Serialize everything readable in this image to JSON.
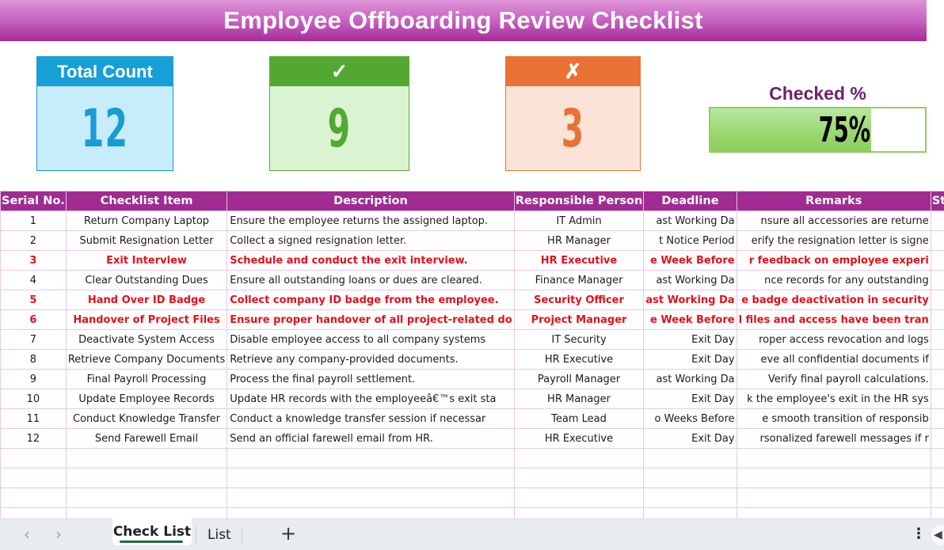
{
  "title": "Employee Offboarding Review Checklist",
  "kpis": {
    "total": {
      "label": "Total Count",
      "value": "12"
    },
    "checked": {
      "label": "✓",
      "value": "9"
    },
    "unchecked": {
      "label": "✗",
      "value": "3"
    }
  },
  "progress": {
    "label": "Checked %",
    "display": "75%",
    "fraction": 0.75
  },
  "colors": {
    "header_purple": "#a02b93",
    "pending_red": "#e3101c",
    "done_green": "#17a34a",
    "total_blue": "#179fd7",
    "checked_green": "#53a832",
    "unchecked_orange": "#e97134"
  },
  "table": {
    "columns": [
      "Serial No.",
      "Checklist Item",
      "Description",
      "Responsible Person",
      "Deadline",
      "Remarks",
      "Status"
    ],
    "rows": [
      {
        "serial": "1",
        "item": "Return Company Laptop",
        "description": "Ensure the employee returns the assigned laptop.",
        "person": "IT Admin",
        "deadline": "ast Working Da",
        "remarks": "nsure all accessories are returne",
        "status": "✓",
        "done": true
      },
      {
        "serial": "2",
        "item": "Submit Resignation Letter",
        "description": "Collect a signed resignation letter.",
        "person": "HR Manager",
        "deadline": "t Notice Period",
        "remarks": "erify the resignation letter is signe",
        "status": "✓",
        "done": true
      },
      {
        "serial": "3",
        "item": "Exit Interview",
        "description": "Schedule and conduct the exit interview.",
        "person": "HR Executive",
        "deadline": "e Week Before",
        "remarks": "r feedback on employee experi",
        "status": "✗",
        "done": false
      },
      {
        "serial": "4",
        "item": "Clear Outstanding Dues",
        "description": "Ensure all outstanding loans or dues are cleared.",
        "person": "Finance Manager",
        "deadline": "ast Working Da",
        "remarks": "nce records for any outstanding",
        "status": "✓",
        "done": true
      },
      {
        "serial": "5",
        "item": "Hand Over ID Badge",
        "description": "Collect company ID badge from the employee.",
        "person": "Security Officer",
        "deadline": "ast Working Da",
        "remarks": "e badge deactivation in security",
        "status": "✗",
        "done": false
      },
      {
        "serial": "6",
        "item": "Handover of Project Files",
        "description": "Ensure proper handover of all project-related do",
        "person": "Project Manager",
        "deadline": "e Week Before",
        "remarks": "l files and access have been tran",
        "status": "✗",
        "done": false
      },
      {
        "serial": "7",
        "item": "Deactivate System Access",
        "description": "Disable employee access to all company systems",
        "person": "IT Security",
        "deadline": "Exit Day",
        "remarks": "roper access revocation and logs",
        "status": "✓",
        "done": true
      },
      {
        "serial": "8",
        "item": "Retrieve Company Documents",
        "description": "Retrieve any company-provided documents.",
        "person": "HR Executive",
        "deadline": "Exit Day",
        "remarks": "eve all confidential documents if",
        "status": "✓",
        "done": true
      },
      {
        "serial": "9",
        "item": "Final Payroll Processing",
        "description": "Process the final payroll settlement.",
        "person": "Payroll Manager",
        "deadline": "ast Working Da",
        "remarks": "Verify final payroll calculations.",
        "status": "✓",
        "done": true
      },
      {
        "serial": "10",
        "item": "Update Employee Records",
        "description": "Update HR records with the employeeâ€™s exit sta",
        "person": "HR Manager",
        "deadline": "Exit Day",
        "remarks": "k the employee's exit in the HR sys",
        "status": "✓",
        "done": true
      },
      {
        "serial": "11",
        "item": "Conduct Knowledge Transfer",
        "description": "Conduct a knowledge transfer session if necessar",
        "person": "Team Lead",
        "deadline": "o Weeks Before",
        "remarks": "e smooth transition of responsib",
        "status": "✓",
        "done": true
      },
      {
        "serial": "12",
        "item": "Send Farewell Email",
        "description": "Send an official farewell email from HR.",
        "person": "HR Executive",
        "deadline": "Exit Day",
        "remarks": "rsonalized farewell messages if r",
        "status": "✓",
        "done": true
      }
    ],
    "empty_rows": 4
  },
  "tabbar": {
    "prev_icon": "‹",
    "next_icon": "›",
    "tabs": [
      {
        "label": "Check List",
        "active": true
      },
      {
        "label": "List",
        "active": false
      }
    ],
    "add_icon": "+",
    "more_icon": "⋮",
    "scroll_icon": "◀"
  }
}
